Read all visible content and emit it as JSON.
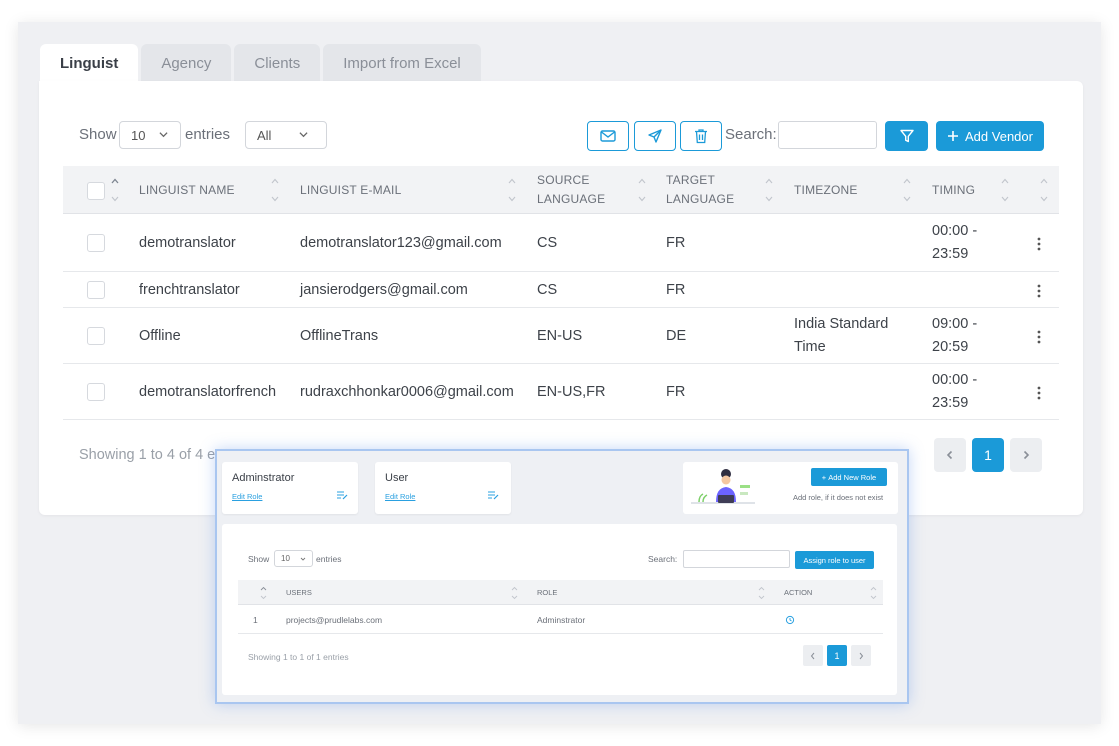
{
  "tabs": [
    "Linguist",
    "Agency",
    "Clients",
    "Import from Excel"
  ],
  "toolbar": {
    "show_label": "Show",
    "entries_value": "10",
    "entries_label": "entries",
    "filter_value": "All",
    "search_label": "Search:",
    "search_value": "",
    "add_vendor_label": "Add Vendor"
  },
  "table": {
    "columns": [
      [
        "LINGUIST NAME"
      ],
      [
        "LINGUIST E-MAIL"
      ],
      [
        "SOURCE",
        "LANGUAGE"
      ],
      [
        "TARGET",
        "LANGUAGE"
      ],
      [
        "TIMEZONE"
      ],
      [
        "TIMING"
      ]
    ],
    "rows": [
      {
        "name": "demotranslator",
        "email": "demotranslator123@gmail.com",
        "source": "CS",
        "target": "FR",
        "timezone": [
          "",
          ""
        ],
        "timing": [
          "00:00 -",
          "23:59"
        ]
      },
      {
        "name": "frenchtranslator",
        "email": "jansierodgers@gmail.com",
        "source": "CS",
        "target": "FR",
        "timezone": [
          "",
          ""
        ],
        "timing": [
          "",
          ""
        ]
      },
      {
        "name": "Offline",
        "email": "OfflineTrans",
        "source": "EN-US",
        "target": "DE",
        "timezone": [
          "India Standard",
          "Time"
        ],
        "timing": [
          "09:00 -",
          "20:59"
        ]
      },
      {
        "name": "demotranslatorfrench",
        "email": "rudraxchhonkar0006@gmail.com",
        "source": "EN-US,FR",
        "target": "FR",
        "timezone": [
          "",
          ""
        ],
        "timing": [
          "00:00 -",
          "23:59"
        ]
      }
    ],
    "showing": "Showing 1 to 4 of 4 e",
    "current_page": "1"
  },
  "roles": {
    "cards": [
      {
        "name": "Adminstrator",
        "edit": "Edit Role"
      },
      {
        "name": "User",
        "edit": "Edit Role"
      }
    ],
    "add_role_label": "Add New Role",
    "add_role_hint": "Add role, if it does not exist",
    "show_label": "Show",
    "entries_value": "10",
    "entries_label": "entries",
    "search_label": "Search:",
    "assign_label": "Assign role to user",
    "columns": [
      "USERS",
      "ROLE",
      "ACTION"
    ],
    "rows": [
      {
        "index": "1",
        "user": "projects@prudlelabs.com",
        "role": "Adminstrator"
      }
    ],
    "showing": "Showing 1 to 1 of 1 entries",
    "current_page": "1"
  },
  "colors": {
    "accent": "#1b9ad8",
    "overlay_border": "#a9c6f0"
  }
}
